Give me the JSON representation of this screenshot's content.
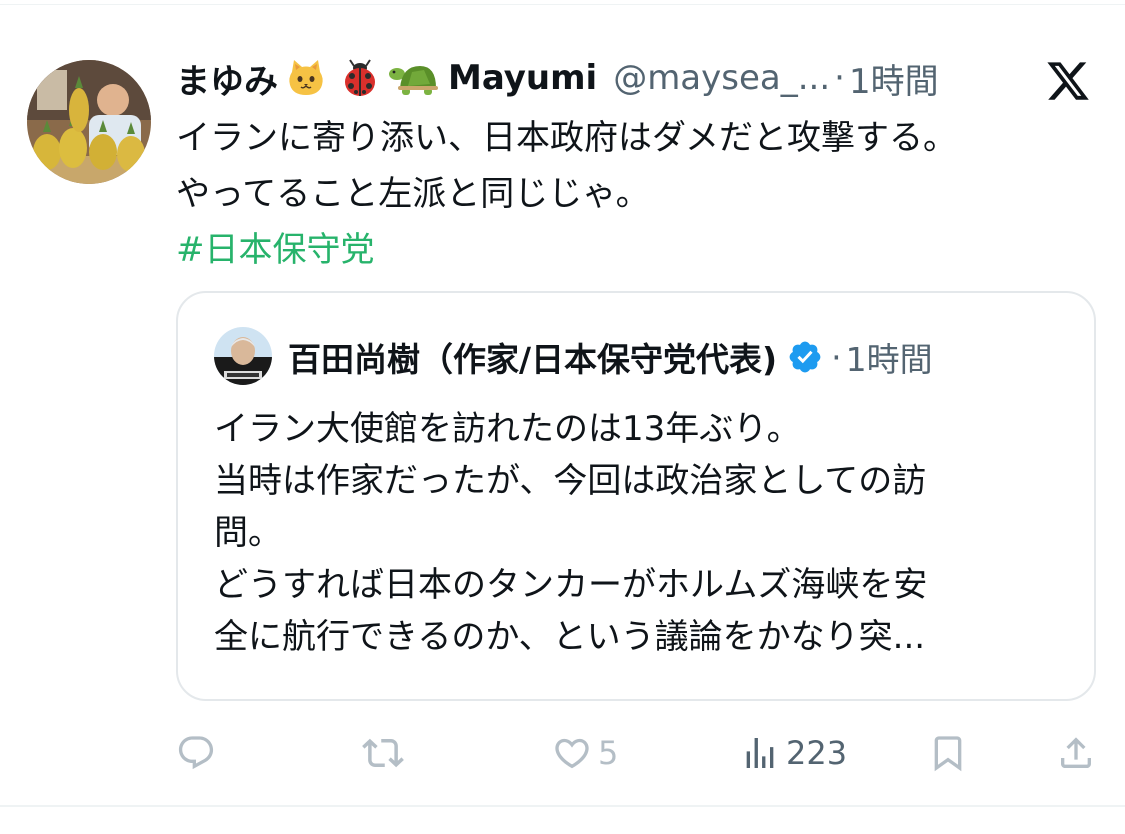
{
  "tweet": {
    "display_name": "まゆみ",
    "display_name_latin": "Mayumi",
    "name_emojis": [
      "cat-face-emoji",
      "ladybug-emoji",
      "turtle-emoji"
    ],
    "handle": "@maysea_...",
    "separator": "·",
    "time": "1時間",
    "text_lines": [
      "イランに寄り添い、日本政府はダメだと攻撃する。",
      "やってること左派と同じじゃ。"
    ],
    "hashtag": "#日本保守党"
  },
  "quote": {
    "author_name": "百田尚樹（作家/日本保守党代表)",
    "separator": "·",
    "time": "1時間",
    "text_lines": [
      "イラン大使館を訪れたのは13年ぶり。",
      "当時は作家だったが、今回は政治家としての訪",
      "問。",
      "どうすれば日本のタンカーがホルムズ海峡を安",
      "全に航行できるのか、という議論をかなり突..."
    ]
  },
  "actions": {
    "reply_count": "",
    "retweet_count": "",
    "like_count": "5",
    "view_count": "223"
  },
  "colors": {
    "hashtag": "#27b36b",
    "verified": "#1d9bf0",
    "muted": "#536471",
    "icon": "#b4bec6"
  }
}
